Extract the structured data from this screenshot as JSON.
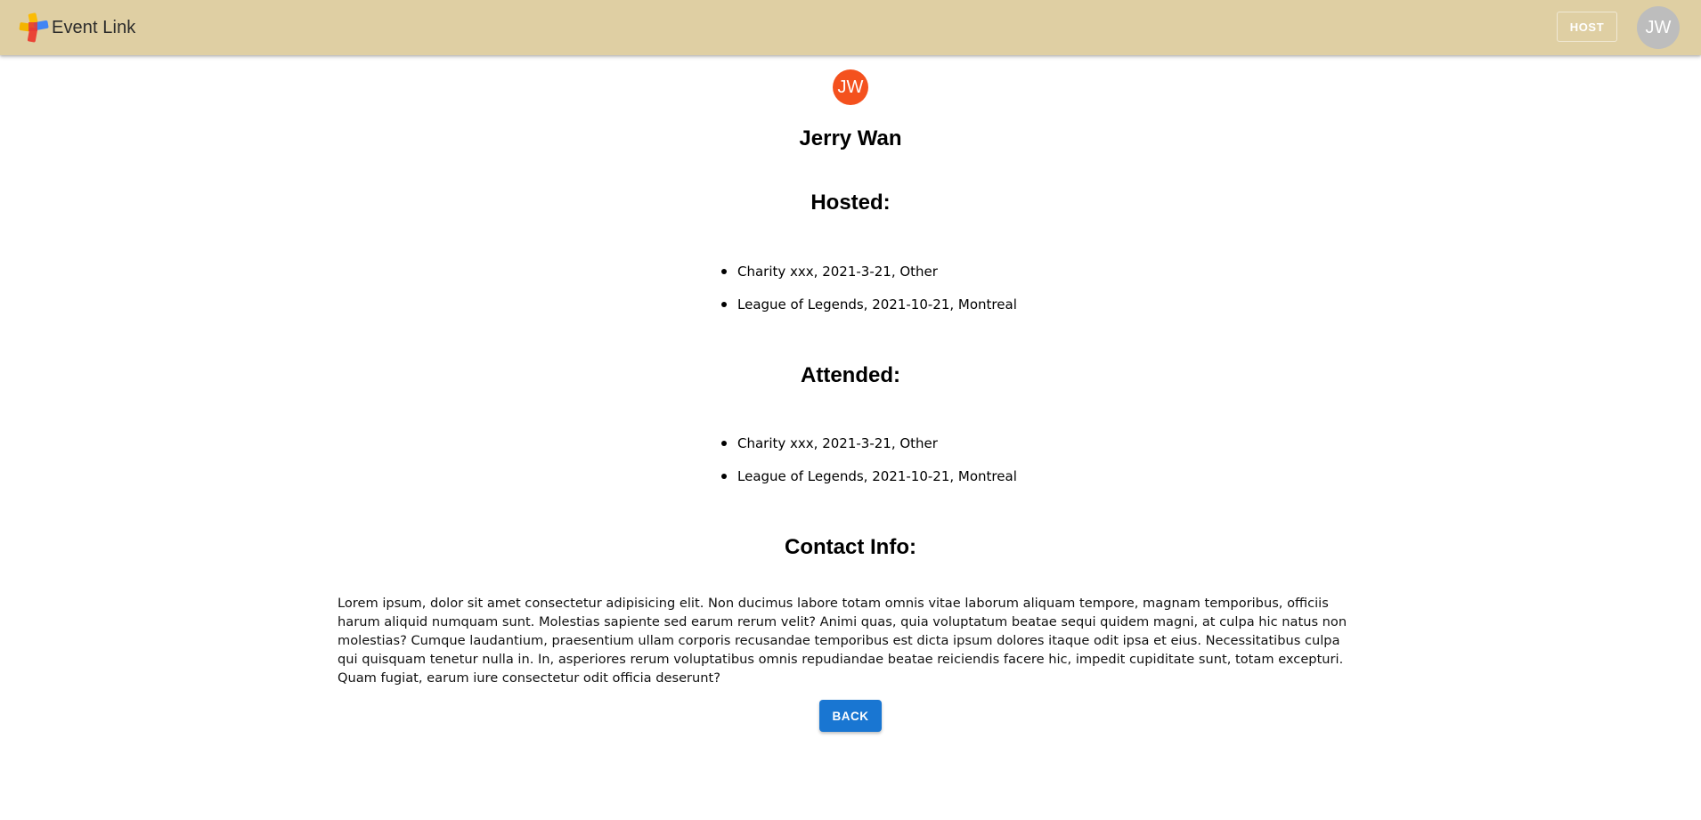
{
  "appbar": {
    "brand_title": "Event Link",
    "host_label": "HOST",
    "user_initials": "JW",
    "background_color": "#dfcfa3"
  },
  "profile": {
    "initials": "JW",
    "avatar_color": "#f4511e",
    "name": "Jerry Wan"
  },
  "hosted": {
    "heading": "Hosted:",
    "events": [
      "Charity xxx, 2021-3-21, Other",
      "League of Legends, 2021-10-21, Montreal"
    ]
  },
  "attended": {
    "heading": "Attended:",
    "events": [
      "Charity xxx, 2021-3-21, Other",
      "League of Legends, 2021-10-21, Montreal"
    ]
  },
  "contact": {
    "heading": "Contact Info:",
    "text": "Lorem ipsum, dolor sit amet consectetur adipisicing elit. Non ducimus labore totam omnis vitae laborum aliquam tempore, magnam temporibus, officiis harum aliquid numquam sunt. Molestias sapiente sed earum rerum velit? Animi quas, quia voluptatum beatae sequi quidem magni, at culpa hic natus non molestias? Cumque laudantium, praesentium ullam corporis recusandae temporibus est dicta ipsum dolores itaque odit ipsa et eius. Necessitatibus culpa qui quisquam tenetur nulla in. In, asperiores rerum voluptatibus omnis repudiandae beatae reiciendis facere hic, impedit cupiditate sunt, totam excepturi. Quam fugiat, earum iure consectetur odit officia deserunt?"
  },
  "actions": {
    "back_label": "BACK",
    "back_color": "#1976d2"
  }
}
